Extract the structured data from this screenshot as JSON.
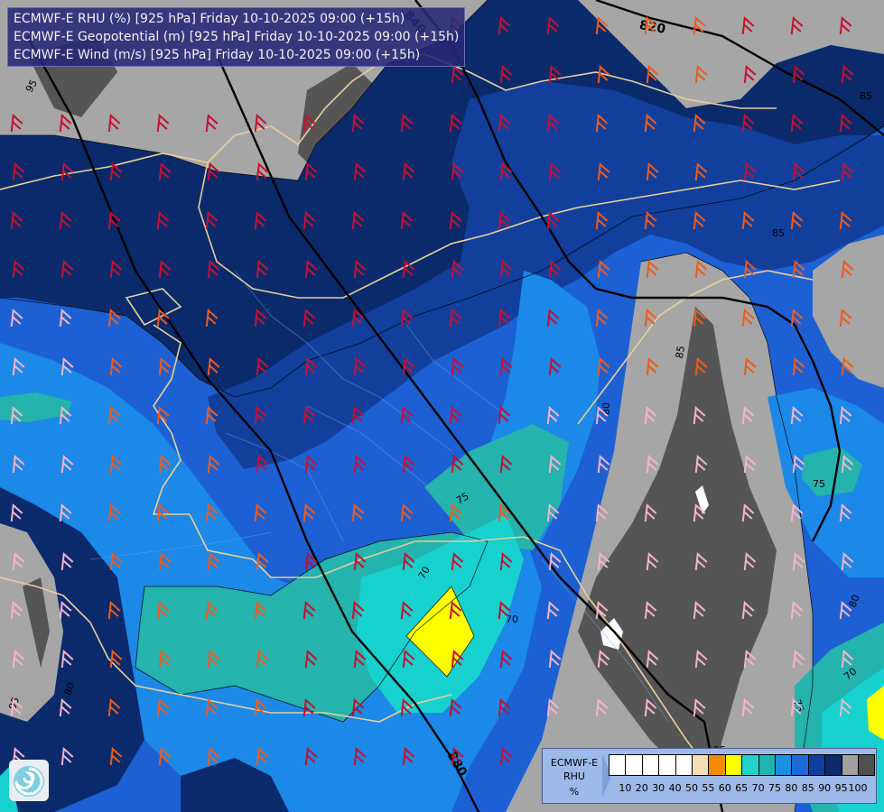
{
  "titles": [
    "ECMWF-E RHU (%) [925 hPa] Friday 10-10-2025 09:00 (+15h)",
    "ECMWF-E Geopotential (m) [925 hPa] Friday 10-10-2025 09:00 (+15h)",
    "ECMWF-E Wind (m/s) [925 hPa] Friday 10-10-2025 09:00 (+15h)"
  ],
  "legend": {
    "model": "ECMWF-E",
    "variable": "RHU",
    "unit": "%",
    "ticks": [
      "10",
      "20",
      "30",
      "40",
      "50",
      "55",
      "60",
      "65",
      "70",
      "75",
      "80",
      "85",
      "90",
      "95",
      "100"
    ],
    "colors": [
      "#ffffff",
      "#ffffff",
      "#ffffff",
      "#ffffff",
      "#ffffff",
      "#f5deb3",
      "#f08c00",
      "#ffff00",
      "#22d2cc",
      "#1eb4b0",
      "#1b8fe0",
      "#1c6ad8",
      "#0f3f9e",
      "#0a2a6c",
      "#a0a0a0",
      "#505050"
    ]
  },
  "geopotential_labels": [
    "820",
    "840",
    "880"
  ],
  "rhu_contour_labels": [
    "95",
    "85",
    "85",
    "85",
    "80",
    "80",
    "80",
    "75",
    "75",
    "75",
    "70",
    "70",
    "70",
    "95",
    "95"
  ],
  "colors": {
    "rh_gray_light": "#a6a6a6",
    "rh_gray_dark": "#555555",
    "rh_navy": "#0a2a6c",
    "rh_dark_blue": "#123f9c",
    "rh_blue": "#1c60d4",
    "rh_mid_blue": "#1c88e8",
    "rh_teal": "#24b3ad",
    "rh_cyan": "#17d1cf",
    "rh_yellow": "#ffff00",
    "border": "#e8cf9a",
    "geopotential_line": "#000000",
    "wind_red": "#c8102e",
    "wind_orange": "#f05a1a",
    "wind_pink": "#f5b3cc"
  }
}
